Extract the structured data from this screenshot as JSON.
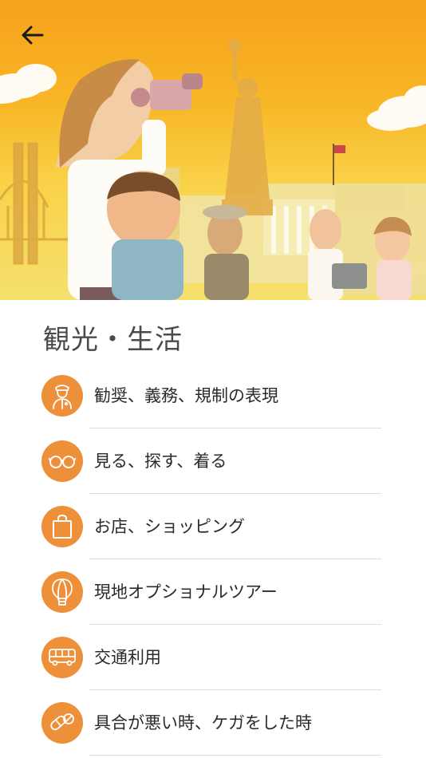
{
  "header": {
    "back_icon": "arrow-left-icon",
    "hero_image": "illustration-tourists-new-york"
  },
  "page": {
    "title": "観光・生活"
  },
  "colors": {
    "accent": "#ee8f3a",
    "hero_top": "#f6a11c",
    "hero_bottom": "#f6e06e",
    "title_text": "#4a4a4a",
    "row_text": "#2a2a2a"
  },
  "items": [
    {
      "label": "勧奨、義務、規制の表現",
      "icon": "police-officer-icon"
    },
    {
      "label": "見る、探す、着る",
      "icon": "glasses-icon"
    },
    {
      "label": "お店、ショッピング",
      "icon": "shopping-bag-icon"
    },
    {
      "label": "現地オプショナルツアー",
      "icon": "hot-air-balloon-icon"
    },
    {
      "label": "交通利用",
      "icon": "bus-icon"
    },
    {
      "label": "具合が悪い時、ケガをした時",
      "icon": "pills-icon"
    }
  ]
}
